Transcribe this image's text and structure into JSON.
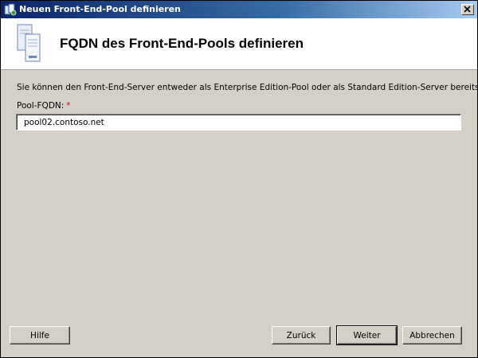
{
  "window": {
    "title": "Neuen Front-End-Pool definieren",
    "close_label": "×"
  },
  "header": {
    "heading": "FQDN des Front-End-Pools definieren",
    "icon": "server-stack-icon"
  },
  "main": {
    "description": "Sie können den Front-End-Server entweder als Enterprise Edition-Pool oder als Standard Edition-Server bereitstellen.",
    "pool_fqdn": {
      "label": "Pool-FQDN:",
      "required_marker": "*",
      "value": "pool02.contoso.net"
    }
  },
  "buttons": {
    "help": "Hilfe",
    "back": "Zurück",
    "next": "Weiter",
    "cancel": "Abbrechen"
  },
  "colors": {
    "titlebar_start": "#0a246a",
    "titlebar_end": "#a6caf0",
    "dialog_background": "#d4d0c8",
    "required_marker": "#cc0000"
  }
}
